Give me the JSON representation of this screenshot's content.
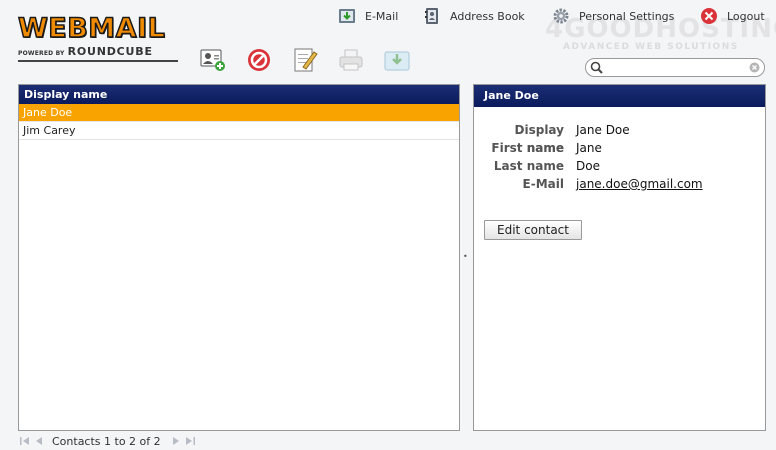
{
  "logo": {
    "word": "WEBMAIL",
    "powered_by": "POWERED BY",
    "brand": "ROUNDCUBE"
  },
  "watermark": {
    "line1": "4GOODHOSTING",
    "line2": "ADVANCED WEB SOLUTIONS"
  },
  "topnav": [
    {
      "label": "E-Mail",
      "icon": "email-icon"
    },
    {
      "label": "Address Book",
      "icon": "address-book-icon"
    },
    {
      "label": "Personal Settings",
      "icon": "gear-icon"
    },
    {
      "label": "Logout",
      "icon": "logout-icon"
    }
  ],
  "toolbar": [
    {
      "icon": "add-contact-icon"
    },
    {
      "icon": "delete-icon"
    },
    {
      "icon": "compose-icon"
    },
    {
      "icon": "print-icon"
    },
    {
      "icon": "export-icon"
    }
  ],
  "search": {
    "value": "",
    "placeholder": ""
  },
  "contacts": {
    "header": "Display name",
    "rows": [
      {
        "name": "Jane Doe",
        "selected": true
      },
      {
        "name": "Jim Carey",
        "selected": false
      }
    ]
  },
  "detail": {
    "title": "Jane Doe",
    "fields": [
      {
        "label": "Display name",
        "value": "Jane Doe"
      },
      {
        "label": "First name",
        "value": "Jane"
      },
      {
        "label": "Last name",
        "value": "Doe"
      },
      {
        "label": "E-Mail",
        "value": "jane.doe@gmail.com"
      }
    ],
    "edit_label": "Edit contact"
  },
  "footer": {
    "count": "Contacts 1 to 2 of 2"
  },
  "colors": {
    "header_bg": "#0a1a5c",
    "selected_row": "#f9a300",
    "logo_orange": "#f08a00"
  }
}
